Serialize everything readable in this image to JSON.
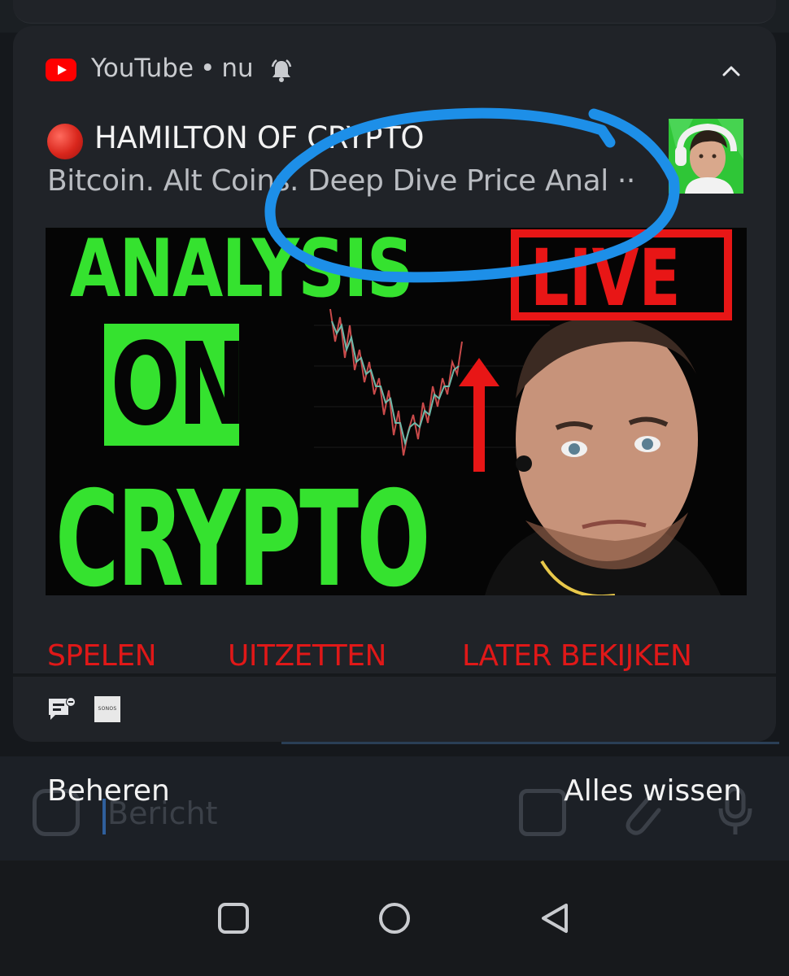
{
  "notification": {
    "app_name": "YouTube",
    "time": "nu",
    "separator": "•",
    "channel_title": "HAMILTON OF CRYPTO",
    "subtitle": "Bitcoin. Alt Coins. Deep Dive Price Anal ··",
    "thumbnail": {
      "line1": "ANALYSIS",
      "line2": "ON",
      "line3": "CRYPTO",
      "badge": "LIVE"
    },
    "actions": {
      "play": "SPELEN",
      "turn_off": "UITZETTEN",
      "watch_later": "LATER BEKIJKEN"
    },
    "footer_icons": [
      "feedback-icon",
      "sonos-icon"
    ],
    "sonos_label": "SONOS"
  },
  "shade": {
    "manage": "Beheren",
    "clear_all": "Alles wissen"
  },
  "background_app": {
    "message_placeholder": "Bericht"
  },
  "nav": {
    "icons": [
      "recents-icon",
      "home-icon",
      "back-icon"
    ]
  },
  "colors": {
    "youtube_red": "#ff0000",
    "action_red": "#e01818",
    "thumb_green": "#35e22f",
    "annotation_blue": "#1d8fe8",
    "card_bg": "#202328"
  }
}
